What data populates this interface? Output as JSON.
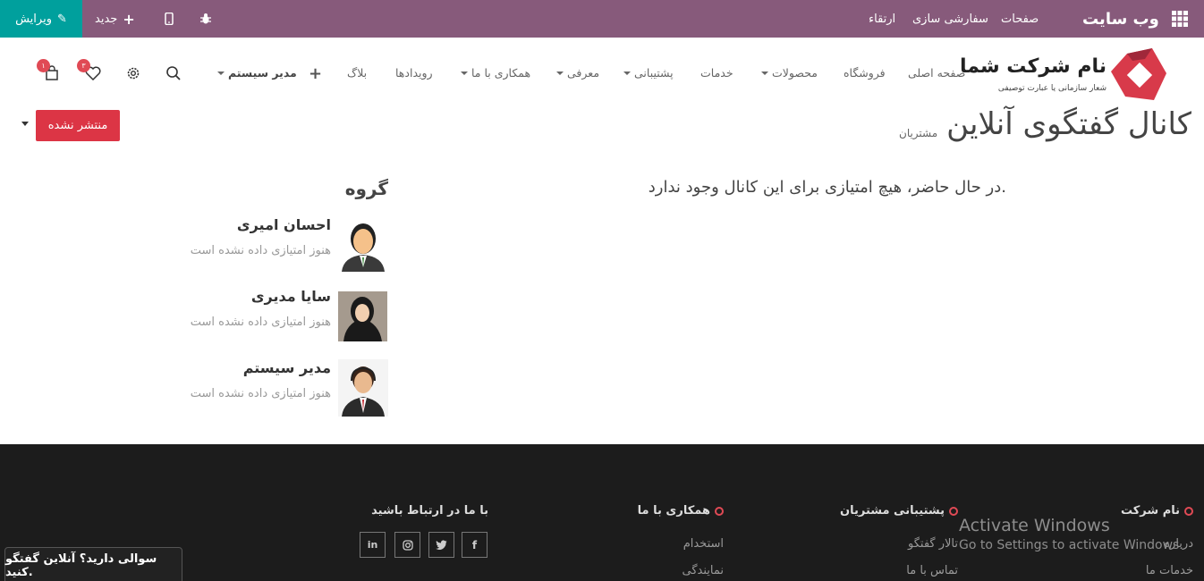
{
  "adminbar": {
    "brand": "وب سایت",
    "menus": [
      "صفحات",
      "سفارشی سازی",
      "ارتقاء"
    ],
    "new_label": "جدید",
    "edit_label": "ویرایش"
  },
  "logo": {
    "name": "نام شرکت شما",
    "tagline": "شعار سازمانی یا عبارت توصیفی"
  },
  "nav": {
    "items": [
      {
        "label": "صفحه اصلی",
        "dropdown": false
      },
      {
        "label": "فروشگاه",
        "dropdown": false
      },
      {
        "label": "محصولات",
        "dropdown": true
      },
      {
        "label": "خدمات",
        "dropdown": false
      },
      {
        "label": "پشتیبانی",
        "dropdown": true
      },
      {
        "label": "معرفی",
        "dropdown": true
      },
      {
        "label": "همکاری با ما",
        "dropdown": true
      },
      {
        "label": "رویدادها",
        "dropdown": false
      },
      {
        "label": "بلاگ",
        "dropdown": false
      }
    ],
    "user": "مدیر سیستم",
    "wishlist_count": "۳",
    "cart_count": "۱"
  },
  "page": {
    "title": "کانال گفتگوی آنلاین",
    "subtitle": "مشتریان",
    "unpublished": "منتشر نشده",
    "no_points": "در حال حاضر، هیچ امتیازی برای این کانال وجود ندارد.",
    "group_title": "گروه"
  },
  "members": [
    {
      "name": "احسان امیری",
      "status": "هنوز امتیازی داده نشده است"
    },
    {
      "name": "سایا مدیری",
      "status": "هنوز امتیازی داده نشده است"
    },
    {
      "name": "مدیر سیستم",
      "status": "هنوز امتیازی داده نشده است"
    }
  ],
  "footer": {
    "col1": {
      "title": "نام شرکت",
      "links": [
        "درباره",
        "خدمات ما"
      ]
    },
    "col2": {
      "title": "پشتیبانی مشتریان",
      "links": [
        "تالار گفتگو",
        "تماس با ما"
      ]
    },
    "col3": {
      "title": "همکاری با ما",
      "links": [
        "استخدام",
        "نمایندگی"
      ]
    },
    "col4": {
      "title": "با ما در ارتباط باشید"
    },
    "socials": [
      "facebook-icon",
      "twitter-icon",
      "instagram-icon",
      "linkedin-icon"
    ]
  },
  "watermark": {
    "line1": "Activate Windows",
    "line2": "Go to Settings to activate Windows."
  },
  "chat_button": "سوالی دارید؟ آنلاین گفتگو کنید.",
  "colors": {
    "admin_bar": "#875a7b",
    "edit": "#00a09d",
    "danger": "#dc3545",
    "footer": "#1c1c1c",
    "accent": "#e04a55"
  }
}
